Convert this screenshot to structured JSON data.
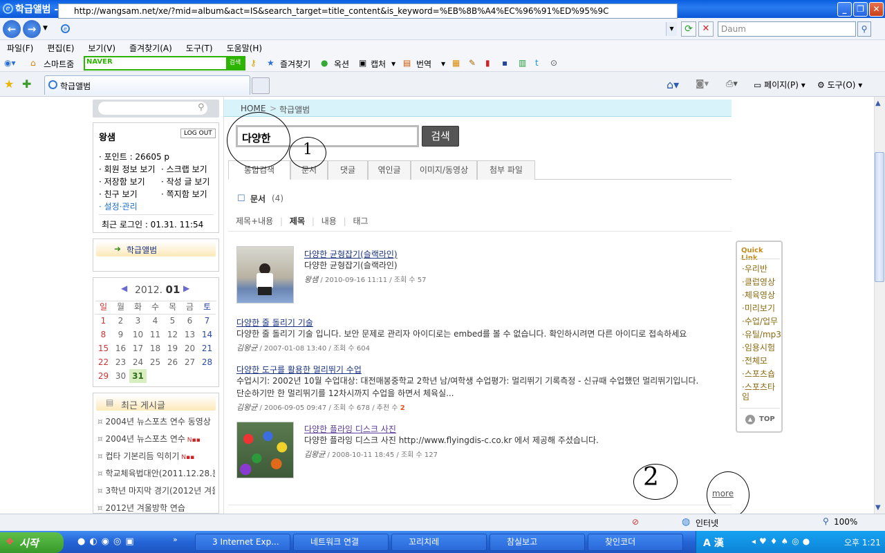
{
  "window": {
    "title": "학급앨범 - Windows Internet Explorer",
    "icon": "ie-icon"
  },
  "address": {
    "url": "http://wangsam.net/xe/?mid=album&act=IS&search_target=title_content&is_keyword=%EB%8B%A4%EC%96%91%ED%95%9C",
    "search_placeholder": "Daum"
  },
  "menu": [
    "파일(F)",
    "편집(E)",
    "보기(V)",
    "즐겨찾기(A)",
    "도구(T)",
    "도움말(H)"
  ],
  "toolbar": {
    "smart": "스마트줌",
    "naver": "NAVER",
    "naver_btn": "검색",
    "fav": "즐겨찾기",
    "option": "옥션",
    "capture": "캡처",
    "translate": "번역"
  },
  "tab": {
    "label": "학급앨범"
  },
  "cmdbar": {
    "page": "페이지(P)",
    "tools": "도구(O)"
  },
  "user": {
    "name": "왕샘",
    "logout": "LOG OUT",
    "points": "· 포인트 : 26605 p",
    "links": [
      "· 회원 정보 보기",
      "· 스크랩 보기",
      "· 저장함 보기",
      "· 작성 글 보기",
      "· 친구 보기",
      "· 쪽지함 보기"
    ],
    "settings": "· 설정·관리",
    "last_login": "최근 로그인 : 01.31. 11:54"
  },
  "menu_box": {
    "label": "학급앨범"
  },
  "calendar": {
    "year": "2012.",
    "month": "01",
    "weekdays": [
      "일",
      "월",
      "화",
      "수",
      "목",
      "금",
      "토"
    ],
    "weeks": [
      [
        "1",
        "2",
        "3",
        "4",
        "5",
        "6",
        "7"
      ],
      [
        "8",
        "9",
        "10",
        "11",
        "12",
        "13",
        "14"
      ],
      [
        "15",
        "16",
        "17",
        "18",
        "19",
        "20",
        "21"
      ],
      [
        "22",
        "23",
        "24",
        "25",
        "26",
        "27",
        "28"
      ],
      [
        "29",
        "30",
        "31",
        "",
        "",
        "",
        ""
      ]
    ]
  },
  "recent": {
    "title": "최근 게시글",
    "items": [
      "2004년 뉴스포츠 연수 동영상",
      "2004년 뉴스포츠 연수",
      "컵타 기본리듬 익히기",
      "학교체육법대안(2011.12.28.본",
      "3학년 마지막 경기(2012년 겨울",
      "2012년 겨울방학 연습"
    ]
  },
  "breadcrumb": {
    "home": "HOME",
    "current": "학급앨범"
  },
  "search": {
    "keyword": "다양한",
    "button": "검색"
  },
  "tabs": [
    "통합검색",
    "문서",
    "댓글",
    "엮인글",
    "이미지/동영상",
    "첨부 파일"
  ],
  "section": {
    "title": "문서",
    "count": "(4)"
  },
  "filters": [
    "제목+내용",
    "제목",
    "내용",
    "태그"
  ],
  "results": [
    {
      "title": "다양한 균형잡기(슬랙라인)",
      "desc": "다양한 균형잡기(슬랙라인)",
      "author": "왕샘",
      "date": "2010-09-16 11:11",
      "views": "조회 수 57"
    },
    {
      "title": "다양한 줄 돌리기 기술",
      "desc": "다양한 줄 돌리기 기술 입니다. 보안 문제로 관리자 아이디로는 embed를 볼 수 없습니다. 확인하시려면 다른 아이디로 접속하세요",
      "author": "김왕균",
      "date": "2007-01-08 13:40",
      "views": "조회 수 604"
    },
    {
      "title": "다양한 도구를 활용한 멀리뛰기 수업",
      "desc": "수업시기: 2002년 10월 수업대상: 대전매봉중학교 2학년 남/여학생 수업평가: 멀리뛰기 기록측정 - 신규때 수업했던 멀리뛰기입니다.",
      "desc2": "단순하기만 한 멀리뛰기를 12차시까지 수업을 하면서 체육실...",
      "author": "김왕균",
      "date": "2006-09-05 09:47",
      "views": "조회 수 678",
      "recommend": "추천 수",
      "rec_count": "2"
    },
    {
      "title": "다양한 플라잉 디스크 사진",
      "desc": "다양한 플라잉 디스크 사진 http://www.flyingdis-c.co.kr 에서 제공해 주셨습니다.",
      "author": "김왕균",
      "date": "2008-10-11 18:45",
      "views": "조회 수 127"
    }
  ],
  "more": "more",
  "quicklink": {
    "title": "Quick Link",
    "items": [
      "우리반",
      "클럽영상",
      "체육영상",
      "미리보기",
      "수업/업무",
      "유틸/mp3",
      "임용시험",
      "전체모",
      "스포츠숍",
      "스포츠타임"
    ],
    "top": "TOP"
  },
  "status": {
    "zone": "인터넷",
    "zoom": "100%"
  },
  "taskbar": {
    "start": "시작",
    "items": [
      "3 Internet Exp...",
      "네트워크 연결",
      "꼬리치레",
      "참실보고",
      "찾인코더"
    ],
    "time": "오후 1:21"
  },
  "annotations": {
    "one": "1",
    "two": "2"
  }
}
